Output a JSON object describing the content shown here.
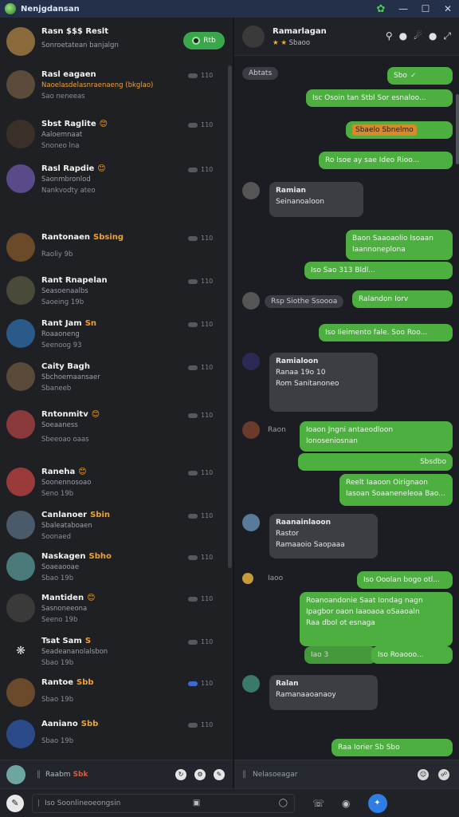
{
  "window": {
    "title": "Nenjgdansan"
  },
  "chats": [
    {
      "name": "Rasn $$$ Reslt",
      "emoji": "$$$",
      "preview": "Sonroetatean banjalgn",
      "meta": "",
      "time": "",
      "button": "Rtb"
    },
    {
      "name": "Rasl eagaen",
      "emoji": "",
      "preview": "Naoelasdelasnraenaeng (bkglao)",
      "meta": "Sao neneeas",
      "time": "110"
    },
    {
      "name": "Sbst Raglite",
      "emoji": "😊",
      "preview": "Aaloemnaat",
      "meta": "Snoneo lna",
      "time": "110"
    },
    {
      "name": "Rasl Rapdie",
      "emoji": "😊",
      "preview": "Saonmbronlod",
      "meta": "Nankvodty ateo",
      "time": "110"
    },
    {
      "name": "Rantonaen",
      "emoji": "Sbsing",
      "preview": "",
      "meta": "Raoliy 9b",
      "time": "110"
    },
    {
      "name": "Rant Rnapelan",
      "emoji": "",
      "preview": "Seasoenaalbs",
      "meta": "Saoeing 19b",
      "time": "110"
    },
    {
      "name": "Rant Jam",
      "emoji": "Sn",
      "preview": "Roaaoneng",
      "meta": "Seenoog 93",
      "time": "110"
    },
    {
      "name": "Caity Bagh",
      "emoji": "",
      "preview": "Sbchoemaansaer",
      "meta": "Sbaneeb",
      "time": "110"
    },
    {
      "name": "Rntonmitv",
      "emoji": "😊",
      "preview": "Soeaaness",
      "meta": "Sbeeoao oaas",
      "time": "110"
    },
    {
      "name": "Raneha",
      "emoji": "😊",
      "preview": "Soonennosoao",
      "meta": "Seno 19b",
      "time": "110"
    },
    {
      "name": "Canlanoer",
      "emoji": "Sbin",
      "preview": "Sbaleataboaen",
      "meta": "Soonaed",
      "time": "110"
    },
    {
      "name": "Naskagen",
      "emoji": "Sbho",
      "preview": "Soaeaooae",
      "meta": "Sbao 19b",
      "time": "110"
    },
    {
      "name": "Mantiden",
      "emoji": "😊",
      "preview": "Sasnoneeona",
      "meta": "Seeno 19b",
      "time": "110"
    },
    {
      "name": "Tsat Sam",
      "emoji": "S",
      "preview": "Seadeananolalsbon",
      "meta": "Sbao 19b",
      "time": "110"
    },
    {
      "name": "Rantoe",
      "emoji": "Sbb",
      "preview": "Soneeeng",
      "meta": "Sbao 19b",
      "time": "110"
    },
    {
      "name": "Aaniano",
      "emoji": "Sbb",
      "preview": "Soonaeeng",
      "meta": "Sbao 19b",
      "time": "110"
    }
  ],
  "left_footer": {
    "label": "Raabm",
    "badge": "Sbk"
  },
  "header": {
    "title": "Ramarlagan",
    "subtitle": "Sbaoo"
  },
  "messages": {
    "sys1": "Abtats",
    "o1": "Sbo",
    "o2": "Isc Osoin tan Stbl Sor esnaloo...",
    "o3": "Sbaelo Sbnelmo",
    "o4": "Ro Isoe ay sae Ideo Rioo...",
    "in1_name": "Ramian",
    "in1_text": "Seinanoaloon",
    "o5a": "Baon Saaoaolio Isoaan",
    "o5b": "Iaannoneplona",
    "o6": "Iso Sao 313 Bldl...",
    "sys2": "Rsp Siothe Ssoooa",
    "o7": "Ralandon Iorv",
    "o8": "Iso Iieimento fale. Soo Roo...",
    "in2_name": "Ramialoon",
    "in2_line2": "Ranaa 19o 10",
    "in2_line3": "Rom Sanitanoneo",
    "small_label": "Raon",
    "o9a": "Ioaon Jngni antaeodloon",
    "o9b": "Ionoseniosnan",
    "o10": "Sbsdbo",
    "o11a": "Reelt Iaaoon Oirignaon",
    "o11b": "Iasoan Soaaneneleoa Bao...",
    "in3_name": "Raanainlaoon",
    "in3_line2": "Rastor",
    "in3_line3": "Ramaaoio Saopaaa",
    "small_label2": "Iaoo",
    "o12": "Iso Ooolan bogo otl...",
    "o13a": "Roanoandonie Saat Iondag nagn",
    "o13b": "Ipagbor oaon Iaaoaoa oSaaoaln",
    "o13c": "Raa dbol ot esnaga",
    "o14a": "Iao 3",
    "o14b": "Iso Roaooo...",
    "in4_name": "Ralan",
    "in4_text": "Ramanaaoanaoy",
    "o15": "Raa Iorier Sb Sbo"
  },
  "composer": {
    "placeholder": "Nelasoeagar"
  },
  "bottom": {
    "search_placeholder": "Iso Soonlineoeongsin"
  }
}
